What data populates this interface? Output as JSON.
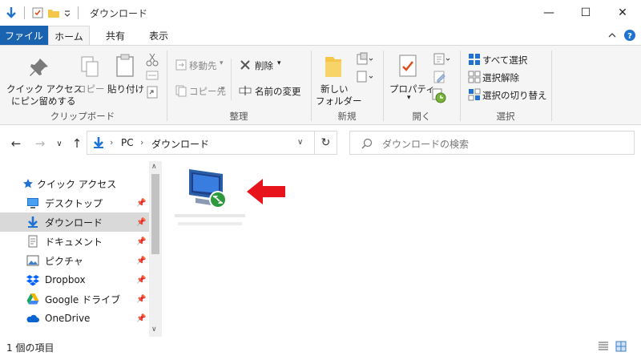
{
  "window": {
    "title": "ダウンロード",
    "controls": {
      "minimize": "—",
      "maximize": "☐",
      "close": "✕"
    }
  },
  "tabs": {
    "file": "ファイル",
    "home": "ホーム",
    "share": "共有",
    "view": "表示"
  },
  "ribbon": {
    "clipboard": {
      "pin_quick_access": [
        "クイック アクセス",
        "にピン留めする"
      ],
      "copy": "コピー",
      "paste": "貼り付け",
      "label": "クリップボード"
    },
    "organize": {
      "move_to": "移動先",
      "copy_to": "コピー先",
      "delete": "削除",
      "rename": "名前の変更",
      "label": "整理"
    },
    "new": {
      "new_folder": [
        "新しい",
        "フォルダー"
      ],
      "label": "新規"
    },
    "open": {
      "properties": "プロパティ",
      "label": "開く"
    },
    "select": {
      "select_all": "すべて選択",
      "select_none": "選択解除",
      "invert": "選択の切り替え",
      "label": "選択"
    }
  },
  "address": {
    "segments": [
      "PC",
      "ダウンロード"
    ],
    "search_placeholder": "ダウンロードの検索"
  },
  "navpane": {
    "quick_access": "クイック アクセス",
    "items": [
      {
        "label": "デスクトップ",
        "pinned": true
      },
      {
        "label": "ダウンロード",
        "pinned": true,
        "selected": true
      },
      {
        "label": "ドキュメント",
        "pinned": true
      },
      {
        "label": "ピクチャ",
        "pinned": true
      },
      {
        "label": "Dropbox",
        "pinned": true
      },
      {
        "label": "Google ドライブ",
        "pinned": true
      },
      {
        "label": "OneDrive",
        "pinned": true
      }
    ]
  },
  "status": {
    "item_count": "1 個の項目"
  },
  "colors": {
    "accent": "#1a63b0",
    "arrow": "#e8141c"
  }
}
